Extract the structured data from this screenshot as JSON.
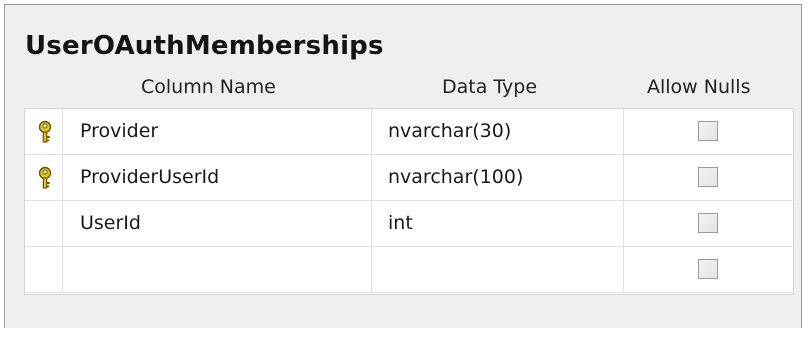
{
  "table": {
    "title": "UserOAuthMemberships",
    "headers": {
      "column_name": "Column Name",
      "data_type": "Data Type",
      "allow_nulls": "Allow Nulls"
    },
    "rows": [
      {
        "primary_key": true,
        "name": "Provider",
        "type": "nvarchar(30)",
        "allow_nulls": false
      },
      {
        "primary_key": true,
        "name": "ProviderUserId",
        "type": "nvarchar(100)",
        "allow_nulls": false
      },
      {
        "primary_key": false,
        "name": "UserId",
        "type": "int",
        "allow_nulls": false
      },
      {
        "primary_key": false,
        "name": "",
        "type": "",
        "allow_nulls": false
      }
    ],
    "icons": {
      "primary_key": "key-icon"
    },
    "colors": {
      "key_gold": "#e3c21a",
      "background": "#efefef"
    }
  }
}
